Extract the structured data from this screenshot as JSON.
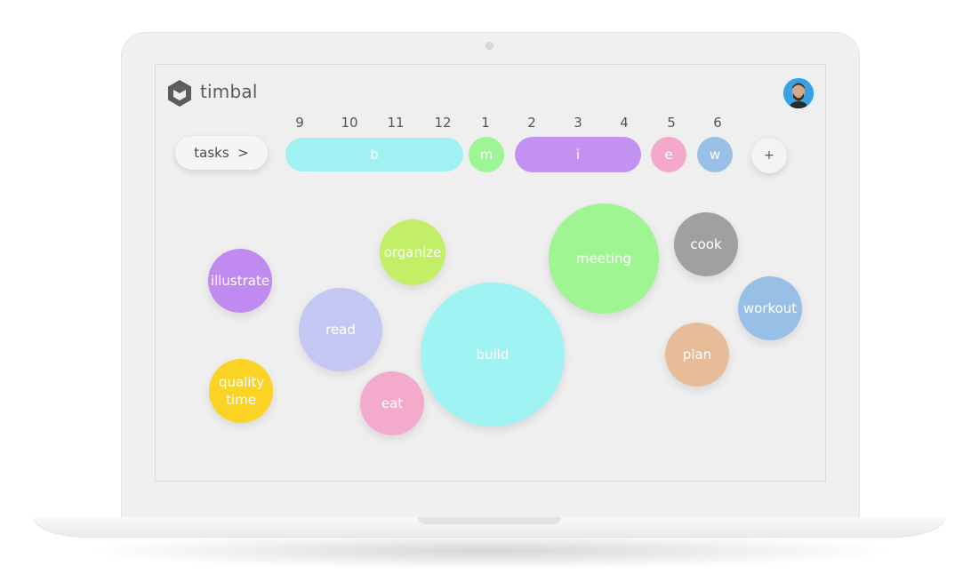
{
  "app": {
    "name": "timbal"
  },
  "header": {
    "avatar": "avatar"
  },
  "hours": [
    "9",
    "10",
    "11",
    "12",
    "1",
    "2",
    "3",
    "4",
    "5",
    "6"
  ],
  "toolbar": {
    "tasks_label": "tasks  >",
    "add_label": "+"
  },
  "schedule": [
    {
      "label": "b",
      "color": "#9ff1f2"
    },
    {
      "label": "m",
      "color": "#9ef595"
    },
    {
      "label": "i",
      "color": "#c391f2"
    },
    {
      "label": "e",
      "color": "#f4a8cc"
    },
    {
      "label": "w",
      "color": "#9ac0e8"
    }
  ],
  "tasks": [
    {
      "label": "illustrate",
      "color": "#c08af0"
    },
    {
      "label": "organize",
      "color": "#c2ef66"
    },
    {
      "label": "read",
      "color": "#c5c7f3"
    },
    {
      "label": "quality time",
      "color": "#fbd324"
    },
    {
      "label": "eat",
      "color": "#f4aacb"
    },
    {
      "label": "build",
      "color": "#9ff3f2"
    },
    {
      "label": "meeting",
      "color": "#9ef592"
    },
    {
      "label": "cook",
      "color": "#a0a0a0"
    },
    {
      "label": "workout",
      "color": "#98c0e6"
    },
    {
      "label": "plan",
      "color": "#e7bc98"
    }
  ]
}
